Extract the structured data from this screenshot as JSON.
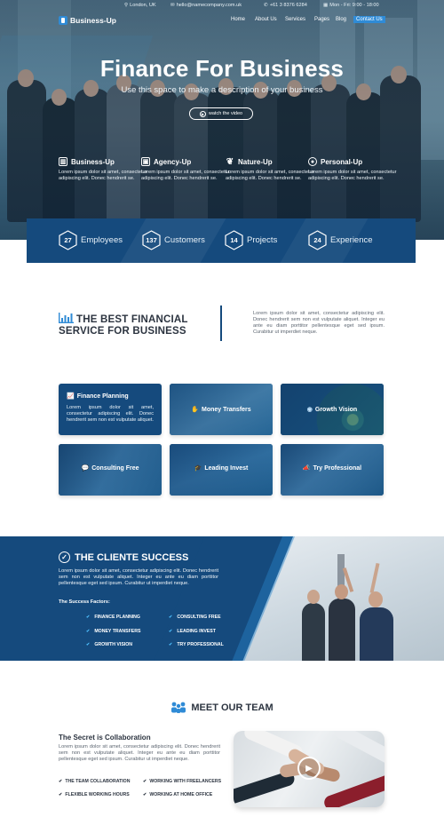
{
  "colors": {
    "brand_dark": "#154a7d",
    "brand_accent": "#2f8bd6",
    "text_dark": "#2c3440"
  },
  "topbar": {
    "location": "London, UK",
    "email": "hello@namecompany.com.uk",
    "phone": "+61 3 8376 6284",
    "hours": "Mon - Fri: 9:00 - 18:00"
  },
  "brand": {
    "name": "Business-Up"
  },
  "nav": [
    "Home",
    "About Us",
    "Services",
    "Pages",
    "Blog",
    "Contact Us"
  ],
  "hero": {
    "title": "Finance For Business",
    "subtitle": "Use this space to make a description of your business",
    "watch_label": "watch the video"
  },
  "features": [
    {
      "title": "Business-Up",
      "icon": "building-icon",
      "desc": "Lorem ipsum dolor sit amet, consectetur adipiscing elit. Donec hendrerit se."
    },
    {
      "title": "Agency-Up",
      "icon": "image-icon",
      "desc": "Lorem ipsum dolor sit amet, consectetur adipiscing elit. Donec hendrerit se."
    },
    {
      "title": "Nature-Up",
      "icon": "leaf-icon",
      "desc": "Lorem ipsum dolor sit amet, consectetur adipiscing elit. Donec hendrerit se."
    },
    {
      "title": "Personal-Up",
      "icon": "user-icon",
      "desc": "Lorem ipsum dolor sit amet, consectetur adipiscing elit. Donec hendrerit se."
    }
  ],
  "stats": [
    {
      "value": "27",
      "label": "Employees"
    },
    {
      "value": "137",
      "label": "Customers"
    },
    {
      "value": "14",
      "label": "Projects"
    },
    {
      "value": "24",
      "label": "Experience"
    }
  ],
  "best": {
    "title_line1": "THE BEST FINANCIAL",
    "title_line2": "SERVICE FOR BUSINESS",
    "text": "Lorem ipsum dolor sit amet, consectetur adipiscing elit. Donec hendrerit sem non est vulputate aliquet. Integer eu ante eu diam porttitor pellentesque eget sed ipsum. Curabitur ut imperdiet neque."
  },
  "services": [
    {
      "title": "Finance Planning",
      "icon": "chart-icon",
      "desc": "Lorem ipsum dolor sit amet, consectetur adipiscing elit. Donec hendrerit sem non est vulputate aliquet."
    },
    {
      "title": "Money Transfers",
      "icon": "hand-coin-icon"
    },
    {
      "title": "Growth Vision",
      "icon": "eye-icon"
    },
    {
      "title": "Consulting Free",
      "icon": "chat-icon"
    },
    {
      "title": "Leading Invest",
      "icon": "graduation-icon"
    },
    {
      "title": "Try Professional",
      "icon": "megaphone-icon"
    }
  ],
  "success": {
    "title": "THE CLIENTE SUCCESS",
    "text": "Lorem ipsum dolor sit amet, consectetur adipiscing elit. Donec hendrerit sem non est vulputate aliquet. Integer eu ante eu diam porttitor pellentesque eget sed ipsum. Curabitur ut imperdiet neque.",
    "factors_label": "The Success Factors:",
    "items": [
      "FINANCE PLANNING",
      "CONSULTING FREE",
      "MONEY TRANSFERS",
      "LEADING INVEST",
      "GROWTH VISION",
      "TRY PROFESSIONAL"
    ]
  },
  "team": {
    "title": "MEET OUR TEAM",
    "subtitle": "The Secret is Collaboration",
    "text": "Lorem ipsum dolor sit amet, consectetur adipiscing elit. Donec hendrerit sem non est vulputate aliquet. Integer eu ante eu diam porttitor pellentesque eget sed ipsum. Curabitur ut imperdiet neque.",
    "items": [
      "THE TEAM COLLABORATION",
      "WORKING WITH FREELANCERS",
      "FLEXIBLE WORKING HOURS",
      "WORKING AT HOME OFFICE"
    ]
  }
}
